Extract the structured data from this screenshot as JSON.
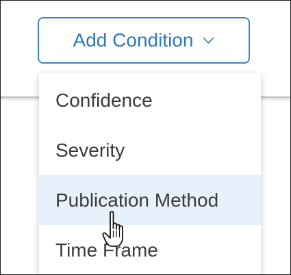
{
  "add_condition": {
    "label": "Add Condition",
    "icon": "chevron-down-icon"
  },
  "dropdown": {
    "items": [
      {
        "label": "Confidence",
        "highlighted": false
      },
      {
        "label": "Severity",
        "highlighted": false
      },
      {
        "label": "Publication Method",
        "highlighted": true
      },
      {
        "label": "Time Frame",
        "highlighted": false
      }
    ]
  },
  "pointer": {
    "icon": "hand-cursor-icon"
  },
  "colors": {
    "accent": "#2f7ab9",
    "button_border": "#3d86c6",
    "menu_text": "#3b3b3b",
    "hover_bg": "#e7f1fb"
  }
}
